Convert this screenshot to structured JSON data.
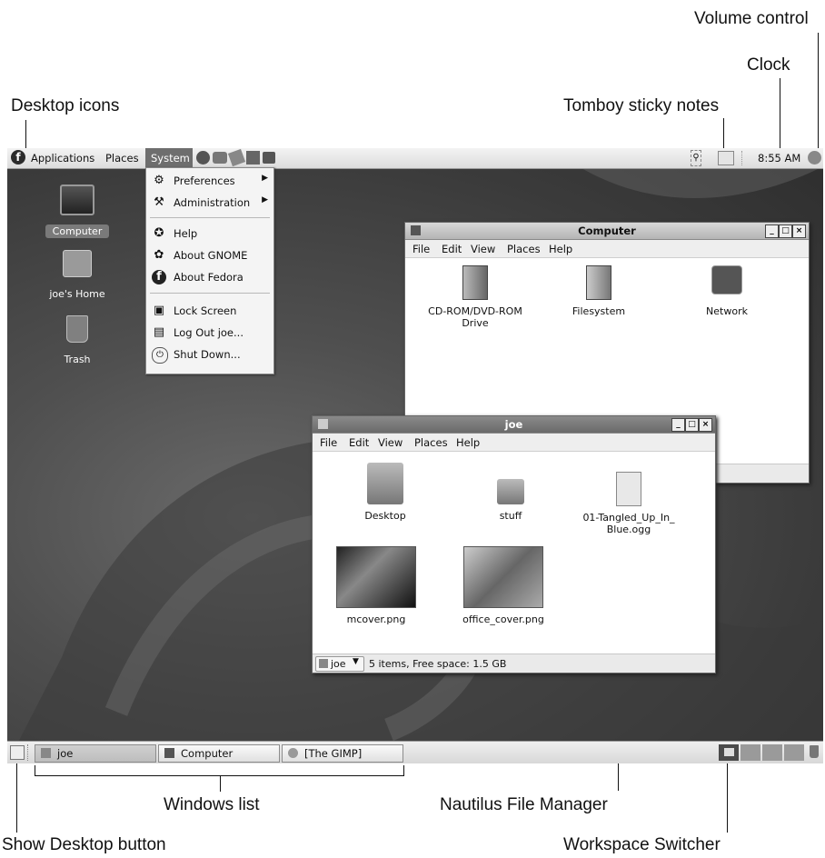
{
  "callouts": {
    "volume_control": "Volume control",
    "clock": "Clock",
    "desktop_icons": "Desktop icons",
    "tomboy": "Tomboy sticky notes",
    "windows_list": "Windows list",
    "nautilus": "Nautilus File Manager",
    "show_desktop": "Show Desktop button",
    "workspace_switcher": "Workspace Switcher"
  },
  "topbar": {
    "applications": "Applications",
    "places": "Places",
    "system": "System",
    "clock": "8:55 AM"
  },
  "system_menu": {
    "items": [
      {
        "label": "Preferences",
        "icon": "preferences-icon",
        "submenu": true
      },
      {
        "label": "Administration",
        "icon": "administration-icon",
        "submenu": true
      },
      {
        "label": "Help",
        "icon": "help-icon",
        "submenu": false
      },
      {
        "label": "About GNOME",
        "icon": "gnome-foot-icon",
        "submenu": false
      },
      {
        "label": "About Fedora",
        "icon": "fedora-icon",
        "submenu": false
      },
      {
        "label": "Lock Screen",
        "icon": "lock-screen-icon",
        "submenu": false
      },
      {
        "label": "Log Out joe...",
        "icon": "logout-icon",
        "submenu": false
      },
      {
        "label": "Shut Down...",
        "icon": "power-icon",
        "submenu": false
      }
    ]
  },
  "desktop_icons": [
    {
      "label": "Computer",
      "icon": "computer-icon"
    },
    {
      "label": "joe's Home",
      "icon": "home-folder-icon"
    },
    {
      "label": "Trash",
      "icon": "trash-icon"
    }
  ],
  "computer_window": {
    "title": "Computer",
    "menu": [
      "File",
      "Edit",
      "View",
      "Places",
      "Help"
    ],
    "items": [
      {
        "label": "CD-ROM/DVD-ROM Drive",
        "icon": "cdrom-drive-icon"
      },
      {
        "label": "Filesystem",
        "icon": "harddisk-icon"
      },
      {
        "label": "Network",
        "icon": "network-icon"
      }
    ]
  },
  "joe_window": {
    "title": "joe",
    "menu": [
      "File",
      "Edit",
      "View",
      "Places",
      "Help"
    ],
    "items": [
      {
        "label": "Desktop",
        "icon": "folder-icon"
      },
      {
        "label": "stuff",
        "icon": "folder-icon"
      },
      {
        "label": "01-Tangled_Up_In_ Blue.ogg",
        "icon": "audio-file-icon"
      },
      {
        "label": "mcover.png",
        "icon": "image-thumbnail-icon"
      },
      {
        "label": "office_cover.png",
        "icon": "image-thumbnail-icon"
      }
    ],
    "location": "joe",
    "status": "5 items, Free space: 1.5 GB"
  },
  "taskbar": {
    "tasks": [
      "joe",
      "Computer",
      "[The GIMP]"
    ]
  }
}
